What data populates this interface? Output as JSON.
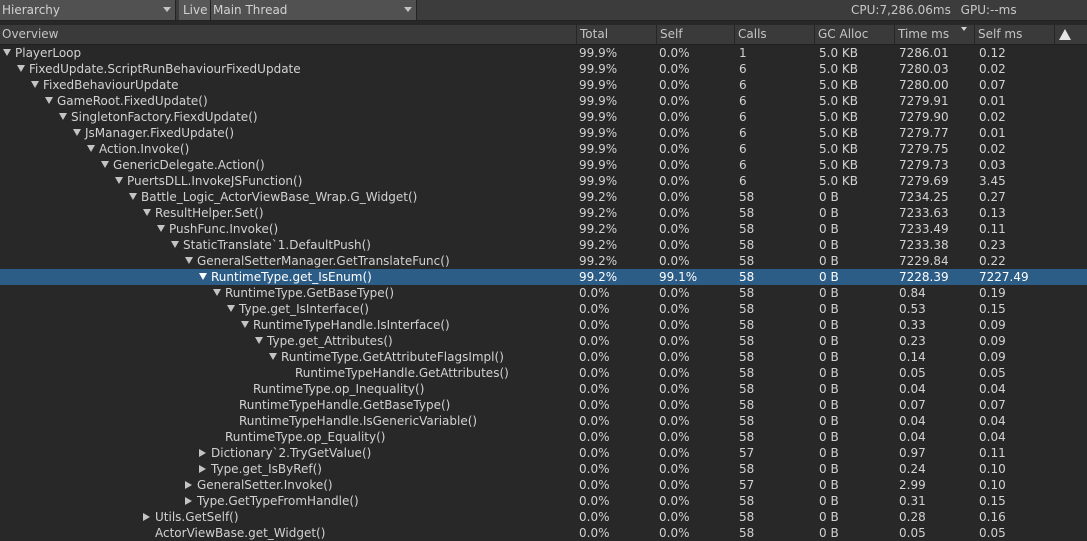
{
  "toolbar": {
    "module_label": "Hierarchy",
    "live_label": "Live",
    "thread_label": "Main Thread",
    "cpu_label": "CPU:7,286.06ms",
    "gpu_label": "GPU:--ms"
  },
  "columns": [
    "Overview",
    "Total",
    "Self",
    "Calls",
    "GC Alloc",
    "Time ms",
    "Self ms"
  ],
  "rows": [
    {
      "depth": 0,
      "expander": "open",
      "name": "PlayerLoop",
      "total": "99.9%",
      "self": "0.0%",
      "calls": "1",
      "gc": "5.0 KB",
      "time": "7286.01",
      "selfms": "0.12"
    },
    {
      "depth": 1,
      "expander": "open",
      "name": "FixedUpdate.ScriptRunBehaviourFixedUpdate",
      "total": "99.9%",
      "self": "0.0%",
      "calls": "6",
      "gc": "5.0 KB",
      "time": "7280.03",
      "selfms": "0.02"
    },
    {
      "depth": 2,
      "expander": "open",
      "name": "FixedBehaviourUpdate",
      "total": "99.9%",
      "self": "0.0%",
      "calls": "6",
      "gc": "5.0 KB",
      "time": "7280.00",
      "selfms": "0.07"
    },
    {
      "depth": 3,
      "expander": "open",
      "name": "GameRoot.FixedUpdate()",
      "total": "99.9%",
      "self": "0.0%",
      "calls": "6",
      "gc": "5.0 KB",
      "time": "7279.91",
      "selfms": "0.01"
    },
    {
      "depth": 4,
      "expander": "open",
      "name": "SingletonFactory.FiexdUpdate()",
      "total": "99.9%",
      "self": "0.0%",
      "calls": "6",
      "gc": "5.0 KB",
      "time": "7279.90",
      "selfms": "0.02"
    },
    {
      "depth": 5,
      "expander": "open",
      "name": "JsManager.FixedUpdate()",
      "total": "99.9%",
      "self": "0.0%",
      "calls": "6",
      "gc": "5.0 KB",
      "time": "7279.77",
      "selfms": "0.01"
    },
    {
      "depth": 6,
      "expander": "open",
      "name": "Action.Invoke()",
      "total": "99.9%",
      "self": "0.0%",
      "calls": "6",
      "gc": "5.0 KB",
      "time": "7279.75",
      "selfms": "0.02"
    },
    {
      "depth": 7,
      "expander": "open",
      "name": "GenericDelegate.Action()",
      "total": "99.9%",
      "self": "0.0%",
      "calls": "6",
      "gc": "5.0 KB",
      "time": "7279.73",
      "selfms": "0.03"
    },
    {
      "depth": 8,
      "expander": "open",
      "name": "PuertsDLL.InvokeJSFunction()",
      "total": "99.9%",
      "self": "0.0%",
      "calls": "6",
      "gc": "5.0 KB",
      "time": "7279.69",
      "selfms": "3.45"
    },
    {
      "depth": 9,
      "expander": "open",
      "name": "Battle_Logic_ActorViewBase_Wrap.G_Widget()",
      "total": "99.2%",
      "self": "0.0%",
      "calls": "58",
      "gc": "0 B",
      "time": "7234.25",
      "selfms": "0.27"
    },
    {
      "depth": 10,
      "expander": "open",
      "name": "ResultHelper.Set()",
      "total": "99.2%",
      "self": "0.0%",
      "calls": "58",
      "gc": "0 B",
      "time": "7233.63",
      "selfms": "0.13"
    },
    {
      "depth": 11,
      "expander": "open",
      "name": "PushFunc.Invoke()",
      "total": "99.2%",
      "self": "0.0%",
      "calls": "58",
      "gc": "0 B",
      "time": "7233.49",
      "selfms": "0.11"
    },
    {
      "depth": 12,
      "expander": "open",
      "name": "StaticTranslate`1.DefaultPush()",
      "total": "99.2%",
      "self": "0.0%",
      "calls": "58",
      "gc": "0 B",
      "time": "7233.38",
      "selfms": "0.23"
    },
    {
      "depth": 13,
      "expander": "open",
      "name": "GeneralSetterManager.GetTranslateFunc()",
      "total": "99.2%",
      "self": "0.0%",
      "calls": "58",
      "gc": "0 B",
      "time": "7229.84",
      "selfms": "0.22"
    },
    {
      "depth": 14,
      "expander": "open",
      "name": "RuntimeType.get_IsEnum()",
      "total": "99.2%",
      "self": "99.1%",
      "calls": "58",
      "gc": "0 B",
      "time": "7228.39",
      "selfms": "7227.49",
      "selected": true
    },
    {
      "depth": 15,
      "expander": "open",
      "name": "RuntimeType.GetBaseType()",
      "total": "0.0%",
      "self": "0.0%",
      "calls": "58",
      "gc": "0 B",
      "time": "0.84",
      "selfms": "0.19"
    },
    {
      "depth": 16,
      "expander": "open",
      "name": "Type.get_IsInterface()",
      "total": "0.0%",
      "self": "0.0%",
      "calls": "58",
      "gc": "0 B",
      "time": "0.53",
      "selfms": "0.15"
    },
    {
      "depth": 17,
      "expander": "open",
      "name": "RuntimeTypeHandle.IsInterface()",
      "total": "0.0%",
      "self": "0.0%",
      "calls": "58",
      "gc": "0 B",
      "time": "0.33",
      "selfms": "0.09"
    },
    {
      "depth": 18,
      "expander": "open",
      "name": "Type.get_Attributes()",
      "total": "0.0%",
      "self": "0.0%",
      "calls": "58",
      "gc": "0 B",
      "time": "0.23",
      "selfms": "0.09"
    },
    {
      "depth": 19,
      "expander": "open",
      "name": "RuntimeType.GetAttributeFlagsImpl()",
      "total": "0.0%",
      "self": "0.0%",
      "calls": "58",
      "gc": "0 B",
      "time": "0.14",
      "selfms": "0.09"
    },
    {
      "depth": 20,
      "expander": "none",
      "name": "RuntimeTypeHandle.GetAttributes()",
      "total": "0.0%",
      "self": "0.0%",
      "calls": "58",
      "gc": "0 B",
      "time": "0.05",
      "selfms": "0.05"
    },
    {
      "depth": 17,
      "expander": "none",
      "name": "RuntimeType.op_Inequality()",
      "total": "0.0%",
      "self": "0.0%",
      "calls": "58",
      "gc": "0 B",
      "time": "0.04",
      "selfms": "0.04"
    },
    {
      "depth": 16,
      "expander": "none",
      "name": "RuntimeTypeHandle.GetBaseType()",
      "total": "0.0%",
      "self": "0.0%",
      "calls": "58",
      "gc": "0 B",
      "time": "0.07",
      "selfms": "0.07"
    },
    {
      "depth": 16,
      "expander": "none",
      "name": "RuntimeTypeHandle.IsGenericVariable()",
      "total": "0.0%",
      "self": "0.0%",
      "calls": "58",
      "gc": "0 B",
      "time": "0.04",
      "selfms": "0.04"
    },
    {
      "depth": 15,
      "expander": "none",
      "name": "RuntimeType.op_Equality()",
      "total": "0.0%",
      "self": "0.0%",
      "calls": "58",
      "gc": "0 B",
      "time": "0.04",
      "selfms": "0.04"
    },
    {
      "depth": 14,
      "expander": "closed",
      "name": "Dictionary`2.TryGetValue()",
      "total": "0.0%",
      "self": "0.0%",
      "calls": "57",
      "gc": "0 B",
      "time": "0.97",
      "selfms": "0.11"
    },
    {
      "depth": 14,
      "expander": "closed",
      "name": "Type.get_IsByRef()",
      "total": "0.0%",
      "self": "0.0%",
      "calls": "58",
      "gc": "0 B",
      "time": "0.24",
      "selfms": "0.10"
    },
    {
      "depth": 13,
      "expander": "closed",
      "name": "GeneralSetter.Invoke()",
      "total": "0.0%",
      "self": "0.0%",
      "calls": "57",
      "gc": "0 B",
      "time": "2.99",
      "selfms": "0.10"
    },
    {
      "depth": 13,
      "expander": "closed",
      "name": "Type.GetTypeFromHandle()",
      "total": "0.0%",
      "self": "0.0%",
      "calls": "58",
      "gc": "0 B",
      "time": "0.31",
      "selfms": "0.15"
    },
    {
      "depth": 10,
      "expander": "closed",
      "name": "Utils.GetSelf()",
      "total": "0.0%",
      "self": "0.0%",
      "calls": "58",
      "gc": "0 B",
      "time": "0.28",
      "selfms": "0.16"
    },
    {
      "depth": 10,
      "expander": "none",
      "name": "ActorViewBase.get_Widget()",
      "total": "0.0%",
      "self": "0.0%",
      "calls": "58",
      "gc": "0 B",
      "time": "0.05",
      "selfms": "0.05"
    }
  ]
}
